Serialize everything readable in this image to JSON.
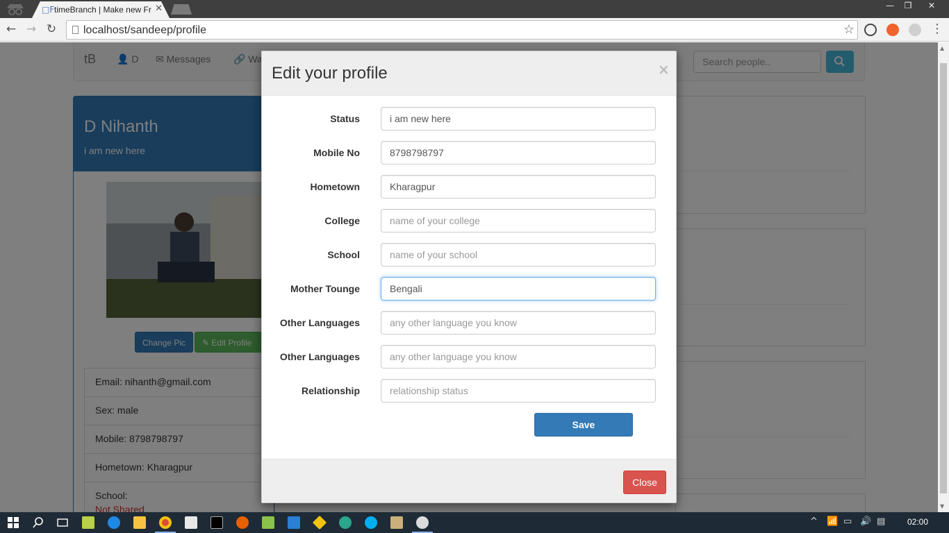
{
  "browser": {
    "tab_title": "timeBranch | Make new Fr",
    "tab_favicon": "□F",
    "url": "localhost/sandeep/profile"
  },
  "site_nav": {
    "brand": "tB",
    "links": [
      "D",
      "Messages",
      "Wal"
    ],
    "search_placeholder": "Search people.."
  },
  "profile": {
    "name": "D Nihanth",
    "status": "i am new here",
    "change_pic_label": "Change Pic",
    "edit_profile_label": "Edit Profile",
    "info": [
      "Email: nihanth@gmail.com",
      "Sex: male",
      "Mobile: 8798798797",
      "Hometown: Kharagpur",
      "School:"
    ],
    "school_value": "Not Shared"
  },
  "modal": {
    "title": "Edit your profile",
    "close_x": "×",
    "fields": [
      {
        "label": "Status",
        "value": "i am new here",
        "placeholder": ""
      },
      {
        "label": "Mobile No",
        "value": "8798798797",
        "placeholder": ""
      },
      {
        "label": "Hometown",
        "value": "Kharagpur",
        "placeholder": ""
      },
      {
        "label": "College",
        "value": "",
        "placeholder": "name of your college"
      },
      {
        "label": "School",
        "value": "",
        "placeholder": "name of your school"
      },
      {
        "label": "Mother Tounge",
        "value": "Bengali",
        "placeholder": ""
      },
      {
        "label": "Other Languages",
        "value": "",
        "placeholder": "any other language you know"
      },
      {
        "label": "Other Languages",
        "value": "",
        "placeholder": "any other language you know"
      },
      {
        "label": "Relationship",
        "value": "",
        "placeholder": "relationship status"
      }
    ],
    "save_label": "Save",
    "close_label": "Close"
  },
  "taskbar": {
    "clock": "02:00"
  },
  "colors": {
    "primary": "#337ab7",
    "success": "#5cb85c",
    "danger": "#d9534f",
    "info": "#46b8da"
  }
}
